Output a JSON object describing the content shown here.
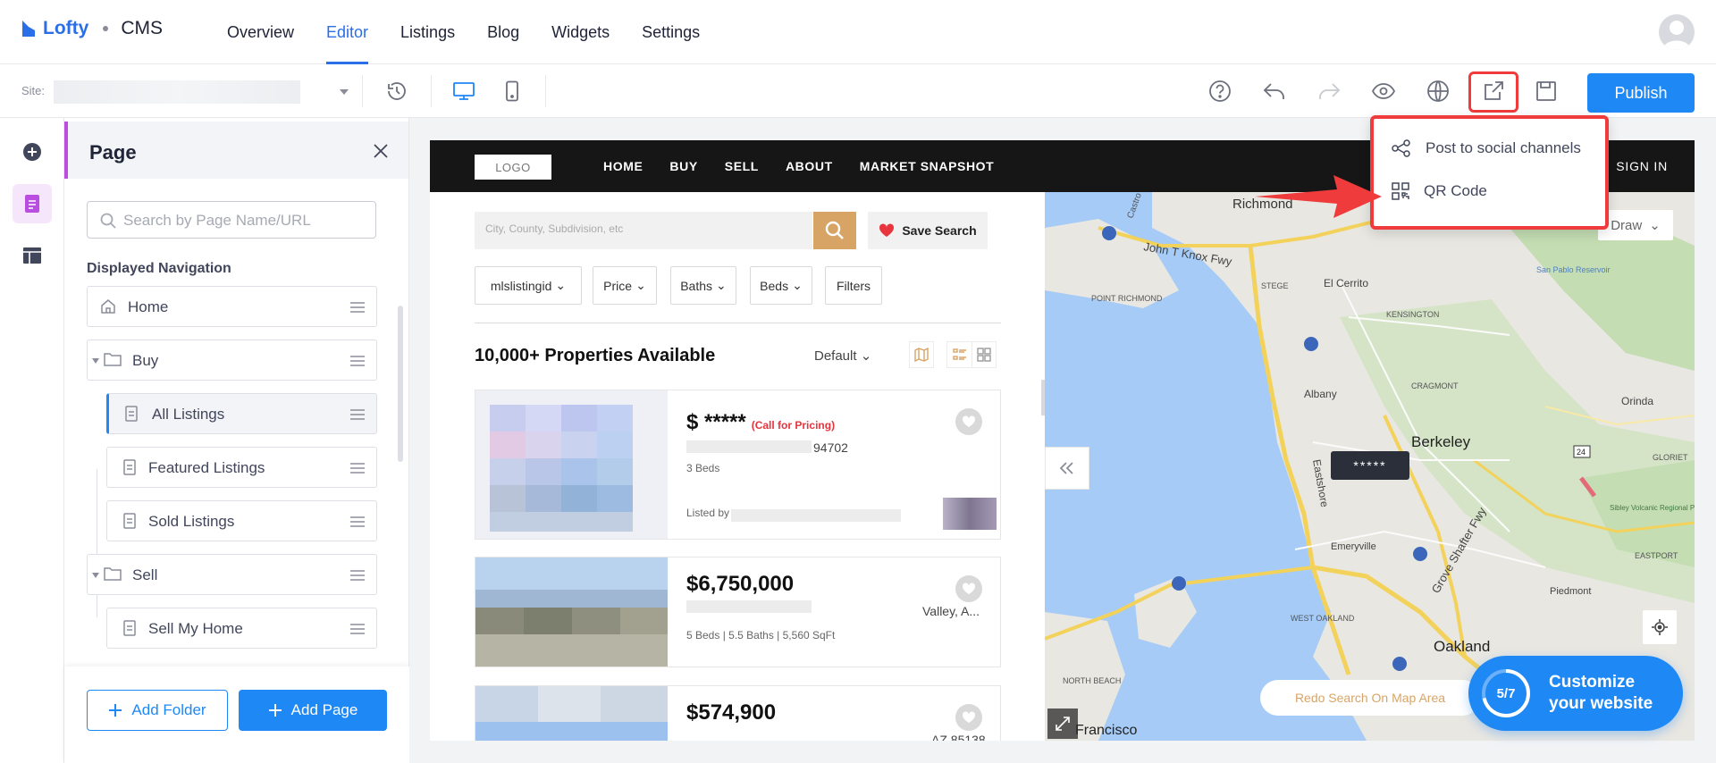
{
  "app": {
    "brand": "Lofty",
    "product": "CMS",
    "nav": [
      "Overview",
      "Editor",
      "Listings",
      "Blog",
      "Widgets",
      "Settings"
    ],
    "active_nav": "Editor"
  },
  "toolbar": {
    "site_label": "Site:",
    "publish_label": "Publish"
  },
  "share_menu": {
    "items": [
      "Post to social channels",
      "QR Code"
    ]
  },
  "panel": {
    "title": "Page",
    "search_placeholder": "Search by Page Name/URL",
    "nav_heading": "Displayed Navigation",
    "items": [
      "Home",
      "Buy",
      "All Listings",
      "Featured Listings",
      "Sold Listings",
      "Sell",
      "Sell My Home"
    ],
    "selected_item": "All Listings",
    "add_folder_label": "Add Folder",
    "add_page_label": "Add Page"
  },
  "site": {
    "logo_text": "LOGO",
    "nav": [
      "HOME",
      "BUY",
      "SELL",
      "ABOUT",
      "MARKET SNAPSHOT"
    ],
    "sign_in": "SIGN IN",
    "search_placeholder": "City, County, Subdivision, etc",
    "save_search_label": "Save Search",
    "filters": [
      "mlslistingid",
      "Price",
      "Baths",
      "Beds",
      "Filters"
    ],
    "results_count": "10,000+ Properties Available",
    "sort_label": "Default",
    "listings": [
      {
        "price": "$ *****",
        "price_note": "(Call for Pricing)",
        "zip": "94702",
        "details": "3 Beds",
        "listed_by": "Listed by"
      },
      {
        "price": "$6,750,000",
        "location": "Valley, A...",
        "details": "5 Beds  |  5.5 Baths  |  5,560 SqFt"
      },
      {
        "price": "$574,900",
        "location": "AZ 85138"
      }
    ],
    "map": {
      "pill_label": "*****",
      "draw_label": "Draw",
      "redo_label": "Redo Search On Map Area",
      "labels": [
        "Richmond",
        "John T Knox Fwy",
        "Castro",
        "POINT RICHMOND",
        "El Cerrito",
        "STEGE",
        "KENSINGTON",
        "San Pablo Reservoir",
        "Albany",
        "CRAGMONT",
        "Orinda",
        "Eastshore",
        "Berkeley",
        "Sibley Volcanic Regional Preserve",
        "GLORIET",
        "Emeryville",
        "Grove Shafter Fwy",
        "EASTPORT",
        "Piedmont",
        "NORTH BEACH",
        "WEST OAKLAND",
        "Oakland",
        "Francisco",
        "24"
      ]
    }
  },
  "customize": {
    "progress": "5/7",
    "progress_fraction": 0.714,
    "label_line1": "Customize",
    "label_line2": "your website"
  },
  "colors": {
    "brand_blue": "#1e88f5",
    "highlight_red": "#ef3b3b",
    "accent_purple": "#b94ee0",
    "gold": "#d8a466"
  }
}
